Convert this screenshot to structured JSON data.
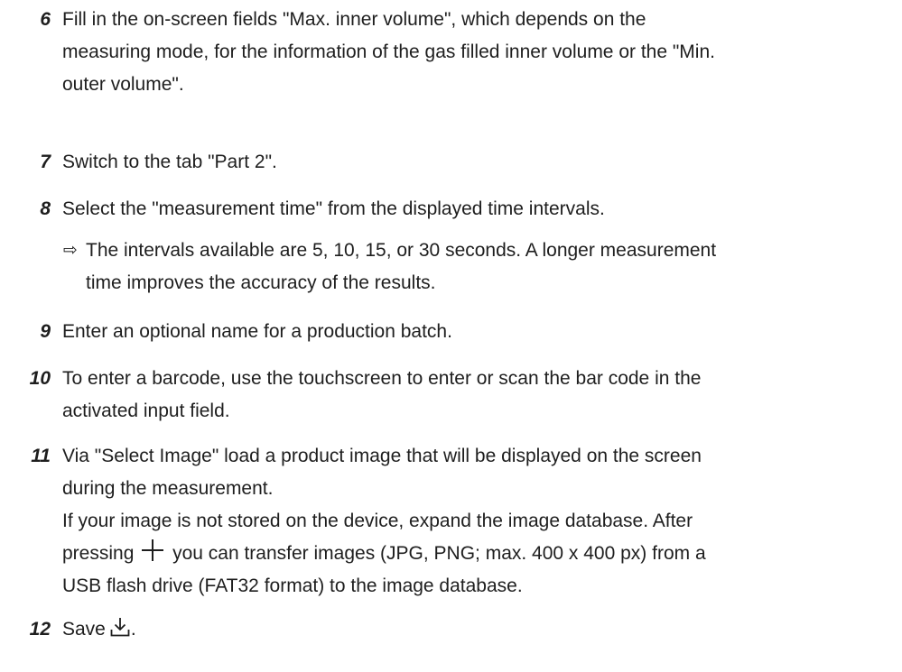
{
  "steps": [
    {
      "number": "6",
      "lines": [
        "Fill in the on-screen fields \"Max. inner volume\", which depends on the",
        "measuring mode, for the information of the gas filled inner volume or the \"Min.",
        "outer volume\"."
      ]
    },
    {
      "number": "7",
      "lines": [
        "Switch to the tab \"Part 2\"."
      ]
    },
    {
      "number": "8",
      "lines": [
        "Select the \"measurement time\" from the displayed time intervals."
      ],
      "result": {
        "arrow": "⇨",
        "lines": [
          "The intervals available are 5, 10, 15, or 30 seconds. A longer measurement",
          "time improves the accuracy of the results."
        ]
      }
    },
    {
      "number": "9",
      "lines": [
        "Enter an optional name for a production batch."
      ]
    },
    {
      "number": "10",
      "lines": [
        "To enter a barcode, use the touchscreen to enter or scan the bar code in the",
        "activated input field."
      ]
    },
    {
      "number": "11",
      "lines": [
        "Via \"Select Image\" load a product image that will be displayed on the screen",
        "during the measurement.",
        "If your image is not stored on the device, expand the image database. After",
        "pressing",
        "you can transfer images (JPG, PNG; max. 400 x 400 px) from a",
        "USB flash drive (FAT32 format) to the image database."
      ]
    },
    {
      "number": "12",
      "lines": [
        "Save",
        "."
      ],
      "icon": "save-download-icon"
    }
  ],
  "icons": {
    "add": "plus-icon",
    "save": "save-download-icon"
  }
}
